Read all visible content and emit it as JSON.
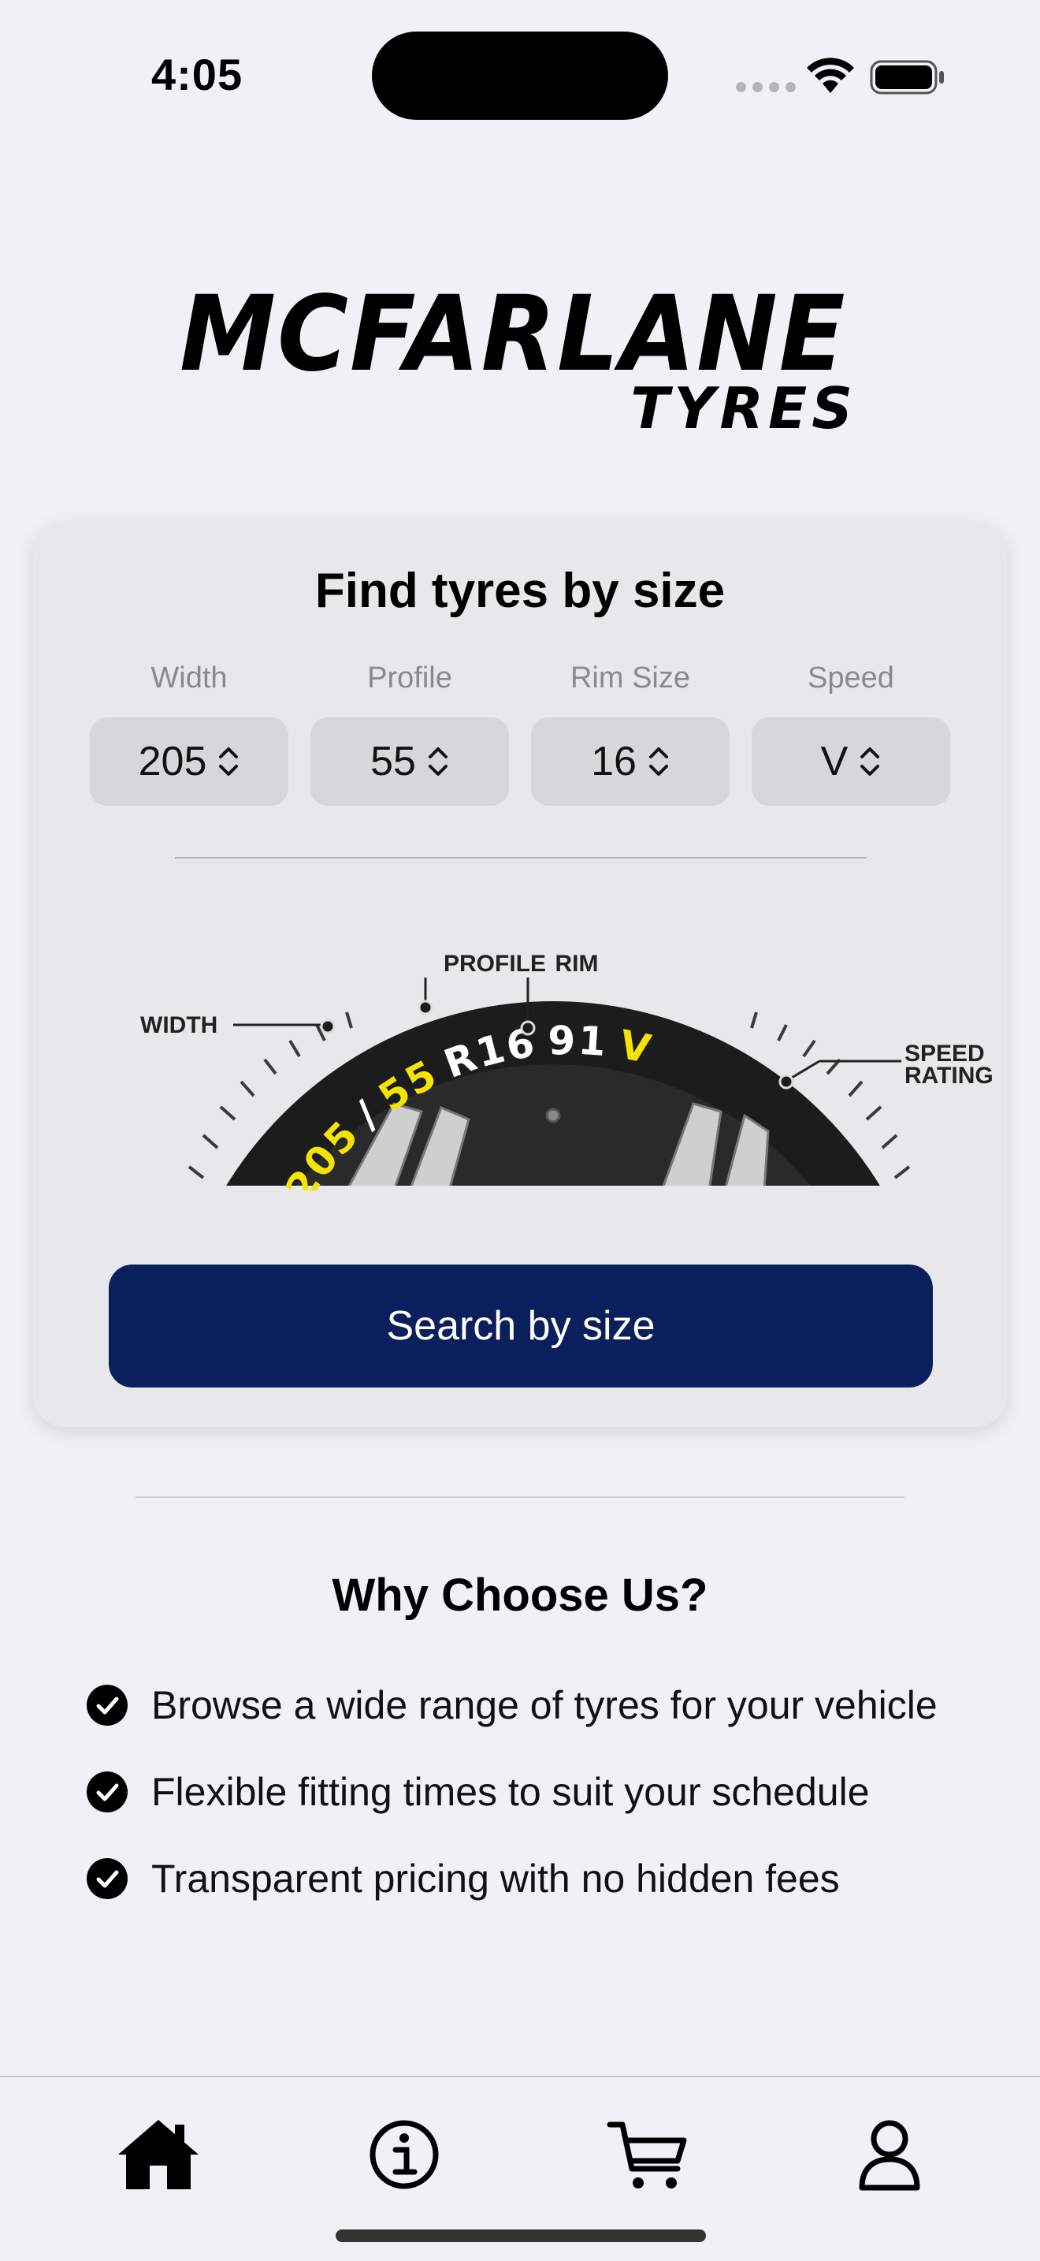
{
  "status_bar": {
    "time": "4:05"
  },
  "logo": {
    "main": "MCFARLANE",
    "sub": "TYRES"
  },
  "size_finder": {
    "title": "Find tyres by size",
    "selectors": [
      {
        "label": "Width",
        "value": "205"
      },
      {
        "label": "Profile",
        "value": "55"
      },
      {
        "label": "Rim Size",
        "value": "16"
      },
      {
        "label": "Speed",
        "value": "V"
      }
    ],
    "diagram": {
      "label_width": "WIDTH",
      "label_profile": "PROFILE",
      "label_rim": "RIM",
      "label_speed_1": "SPEED",
      "label_speed_2": "RATING",
      "tyre_text": [
        "205",
        "/",
        "55",
        "R16",
        "91",
        "V"
      ]
    },
    "search_button": "Search by size"
  },
  "why": {
    "title": "Why Choose Us?",
    "items": [
      "Browse a wide range of tyres for your vehicle",
      "Flexible fitting times to suit your schedule",
      "Transparent pricing with no hidden fees"
    ]
  },
  "tabs": [
    {
      "icon": "home-icon"
    },
    {
      "icon": "info-icon"
    },
    {
      "icon": "cart-icon"
    },
    {
      "icon": "person-icon"
    }
  ],
  "colors": {
    "accent": "#0b1f5c",
    "background": "#f1f0f5",
    "tyre_highlight": "#f5e400"
  }
}
